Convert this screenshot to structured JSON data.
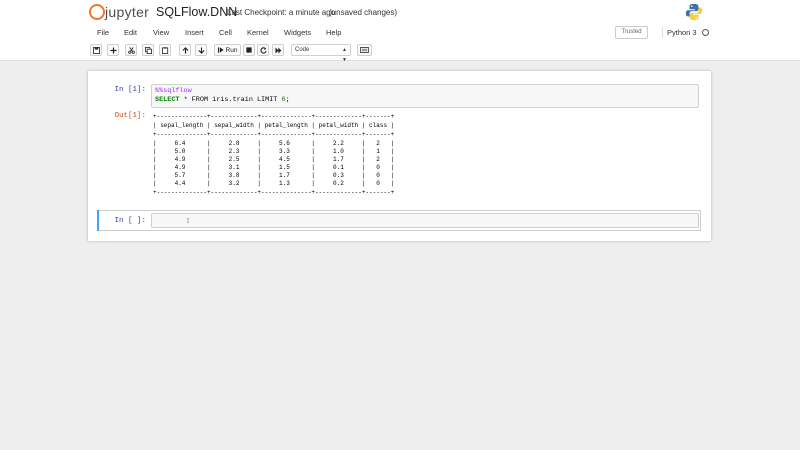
{
  "header": {
    "logo_text": "jupyter",
    "notebook_name": "SQLFlow.DNN",
    "checkpoint": "Last Checkpoint: a minute ago",
    "unsaved": "(unsaved changes)",
    "brand_color": "#f37726"
  },
  "menubar": {
    "items": [
      "File",
      "Edit",
      "View",
      "Insert",
      "Cell",
      "Kernel",
      "Widgets",
      "Help"
    ],
    "trusted": "Trusted",
    "kernel": "Python 3"
  },
  "toolbar": {
    "icons": [
      "save-icon",
      "add-cell-icon",
      "cut-icon",
      "copy-icon",
      "paste-icon",
      "move-up-icon",
      "move-down-icon",
      "run-icon",
      "stop-icon",
      "restart-icon",
      "fast-forward-icon",
      "command-palette-icon"
    ],
    "run_label": "Run",
    "cell_type": "Code"
  },
  "cells": [
    {
      "prompt": "In [1]:",
      "code_magic": "%%sqlflow",
      "code_line1_kw1": "SELECT",
      "code_line1_rest": " * FROM iris.train LIMIT ",
      "code_line1_num": "6",
      "code_line1_end": ";",
      "out_prompt": "Out[1]:",
      "table_lines": [
        "+--------------+-------------+--------------+-------------+-------+",
        "| sepal_length | sepal_width | petal_length | petal_width | class |",
        "+--------------+-------------+--------------+-------------+-------+",
        "|     6.4      |     2.8     |     5.6      |     2.2     |   2   |",
        "|     5.0      |     2.3     |     3.3      |     1.0     |   1   |",
        "|     4.9      |     2.5     |     4.5      |     1.7     |   2   |",
        "|     4.9      |     3.1     |     1.5      |     0.1     |   0   |",
        "|     5.7      |     3.8     |     1.7      |     0.3     |   0   |",
        "|     4.4      |     3.2     |     1.3      |     0.2     |   0   |",
        "+--------------+-------------+--------------+-------------+-------+"
      ]
    },
    {
      "prompt": "In [ ]:"
    }
  ]
}
